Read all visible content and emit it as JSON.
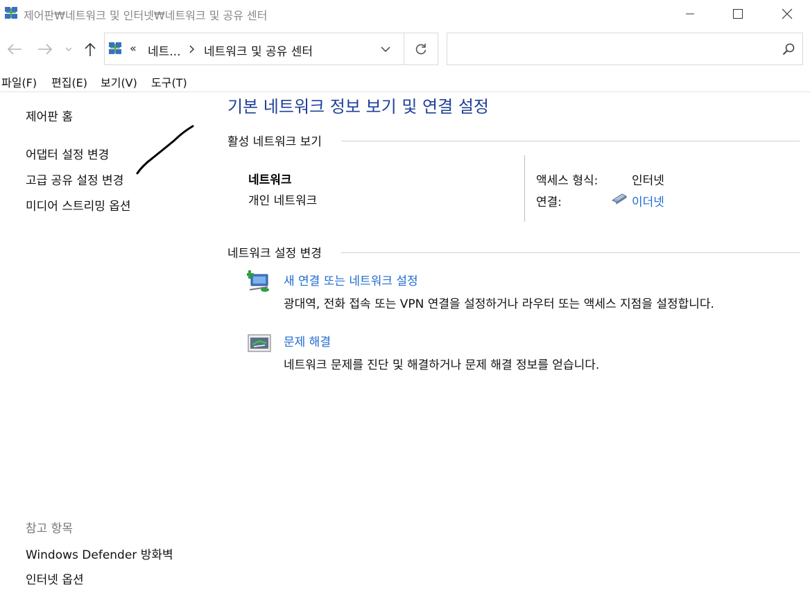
{
  "window": {
    "title": "제어판₩네트워크 및 인터넷₩네트워크 및 공유 센터"
  },
  "address_bar": {
    "overflow_chevron": "«",
    "crumbs": [
      "네트...",
      "네트워크 및 공유 센터"
    ]
  },
  "search": {
    "placeholder": ""
  },
  "menu": {
    "items": [
      "파일(F)",
      "편집(E)",
      "보기(V)",
      "도구(T)"
    ]
  },
  "left_pane": {
    "links": [
      "제어판 홈",
      "어댑터 설정 변경",
      "고급 공유 설정 변경",
      "미디어 스트리밍 옵션"
    ],
    "see_also_title": "참고 항목",
    "see_also_links": [
      "Windows Defender 방화벽",
      "인터넷 옵션"
    ]
  },
  "main": {
    "title": "기본 네트워크 정보 보기 및 연결 설정",
    "active_network_heading": "활성 네트워크 보기",
    "network_name": "네트워크",
    "network_type": "개인 네트워크",
    "access_type_label": "액세스 형식:",
    "access_type_value": "인터넷",
    "connections_label": "연결:",
    "connections_value": "이더넷",
    "change_settings_heading": "네트워크 설정 변경",
    "tasks": [
      {
        "title": "새 연결 또는 네트워크 설정",
        "description": "광대역, 전화 접속 또는 VPN 연결을 설정하거나 라우터 또는 액세스 지점을 설정합니다.",
        "icon": "new-connection-icon"
      },
      {
        "title": "문제 해결",
        "description": "네트워크 문제를 진단 및 해결하거나 문제 해결 정보를 얻습니다.",
        "icon": "troubleshoot-icon"
      }
    ]
  },
  "colors": {
    "title_blue": "#1f3f99",
    "link_blue": "#1f6bd1",
    "muted_gray": "#777777"
  }
}
